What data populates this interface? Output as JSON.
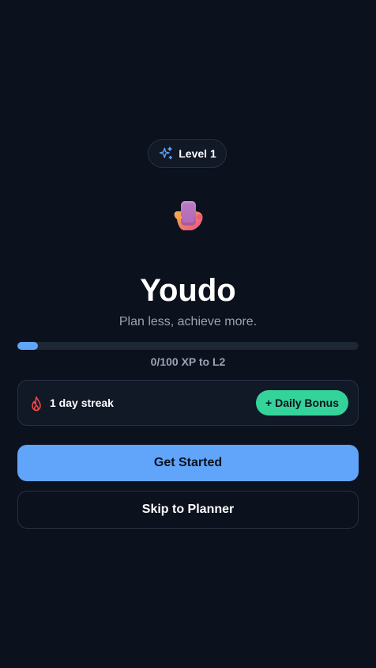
{
  "level_badge": {
    "icon": "sparkles-icon",
    "label": "Level 1"
  },
  "hero": {
    "icon": "phone-hand-icon",
    "title": "Youdo",
    "tagline": "Plan less, achieve more."
  },
  "xp": {
    "progress_fraction": 0.0,
    "label": "0/100 XP to L2"
  },
  "streak": {
    "icon": "flame-icon",
    "label": "1 day streak",
    "bonus_button_label": "+ Daily Bonus"
  },
  "actions": {
    "primary_label": "Get Started",
    "secondary_label": "Skip to Planner"
  },
  "colors": {
    "background": "#0b111d",
    "accent_blue": "#60a5fa",
    "accent_green": "#34d399",
    "streak_red": "#ef4444"
  }
}
